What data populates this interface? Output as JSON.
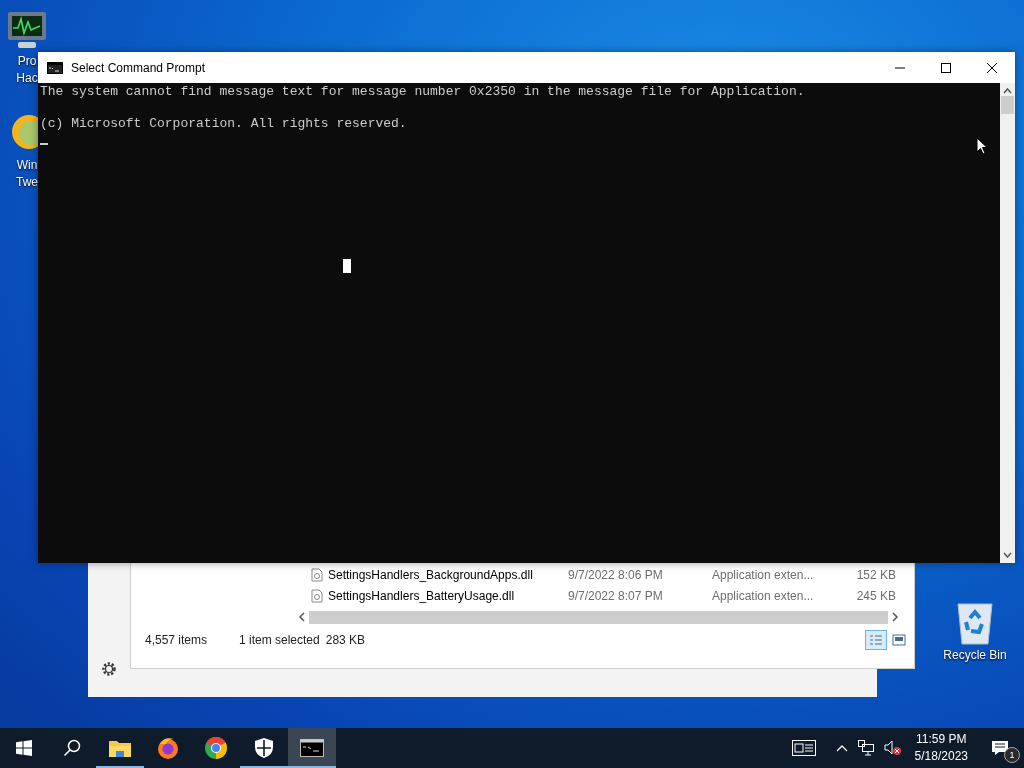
{
  "desktop_icons": [
    {
      "kind": "monitor",
      "lines": [
        "Pro",
        "Hac"
      ]
    },
    {
      "kind": "globe",
      "lines": [
        "Win",
        "Twe"
      ]
    },
    {
      "kind": "recycle",
      "lines": [
        "Recycle Bin"
      ]
    }
  ],
  "explorer": {
    "rows": [
      {
        "name": "SettingsHandlers_BackgroundApps.dll",
        "date": "9/7/2022 8:06 PM",
        "type": "Application exten...",
        "size": "152 KB"
      },
      {
        "name": "SettingsHandlers_BatteryUsage.dll",
        "date": "9/7/2022 8:07 PM",
        "type": "Application exten...",
        "size": "245 KB"
      }
    ],
    "status": {
      "items": "4,557 items",
      "selection": "1 item selected",
      "size": "283 KB"
    },
    "views": [
      {
        "kind": "details",
        "selected": true
      },
      {
        "kind": "tiles",
        "selected": false
      }
    ]
  },
  "console": {
    "title": "Select Command Prompt",
    "lines": [
      "The system cannot find message text for message number 0x2350 in the message file for Application.",
      "(c) Microsoft Corporation. All rights reserved."
    ]
  },
  "taskbar": {
    "apps": [
      {
        "kind": "explorer",
        "running": true,
        "active": false
      },
      {
        "kind": "firefox",
        "running": false,
        "active": false
      },
      {
        "kind": "chrome",
        "running": false,
        "active": false
      },
      {
        "kind": "security",
        "running": true,
        "active": false
      },
      {
        "kind": "console",
        "running": true,
        "active": true
      }
    ],
    "time": "11:59 PM",
    "date": "5/18/2023",
    "notifications": "1"
  }
}
